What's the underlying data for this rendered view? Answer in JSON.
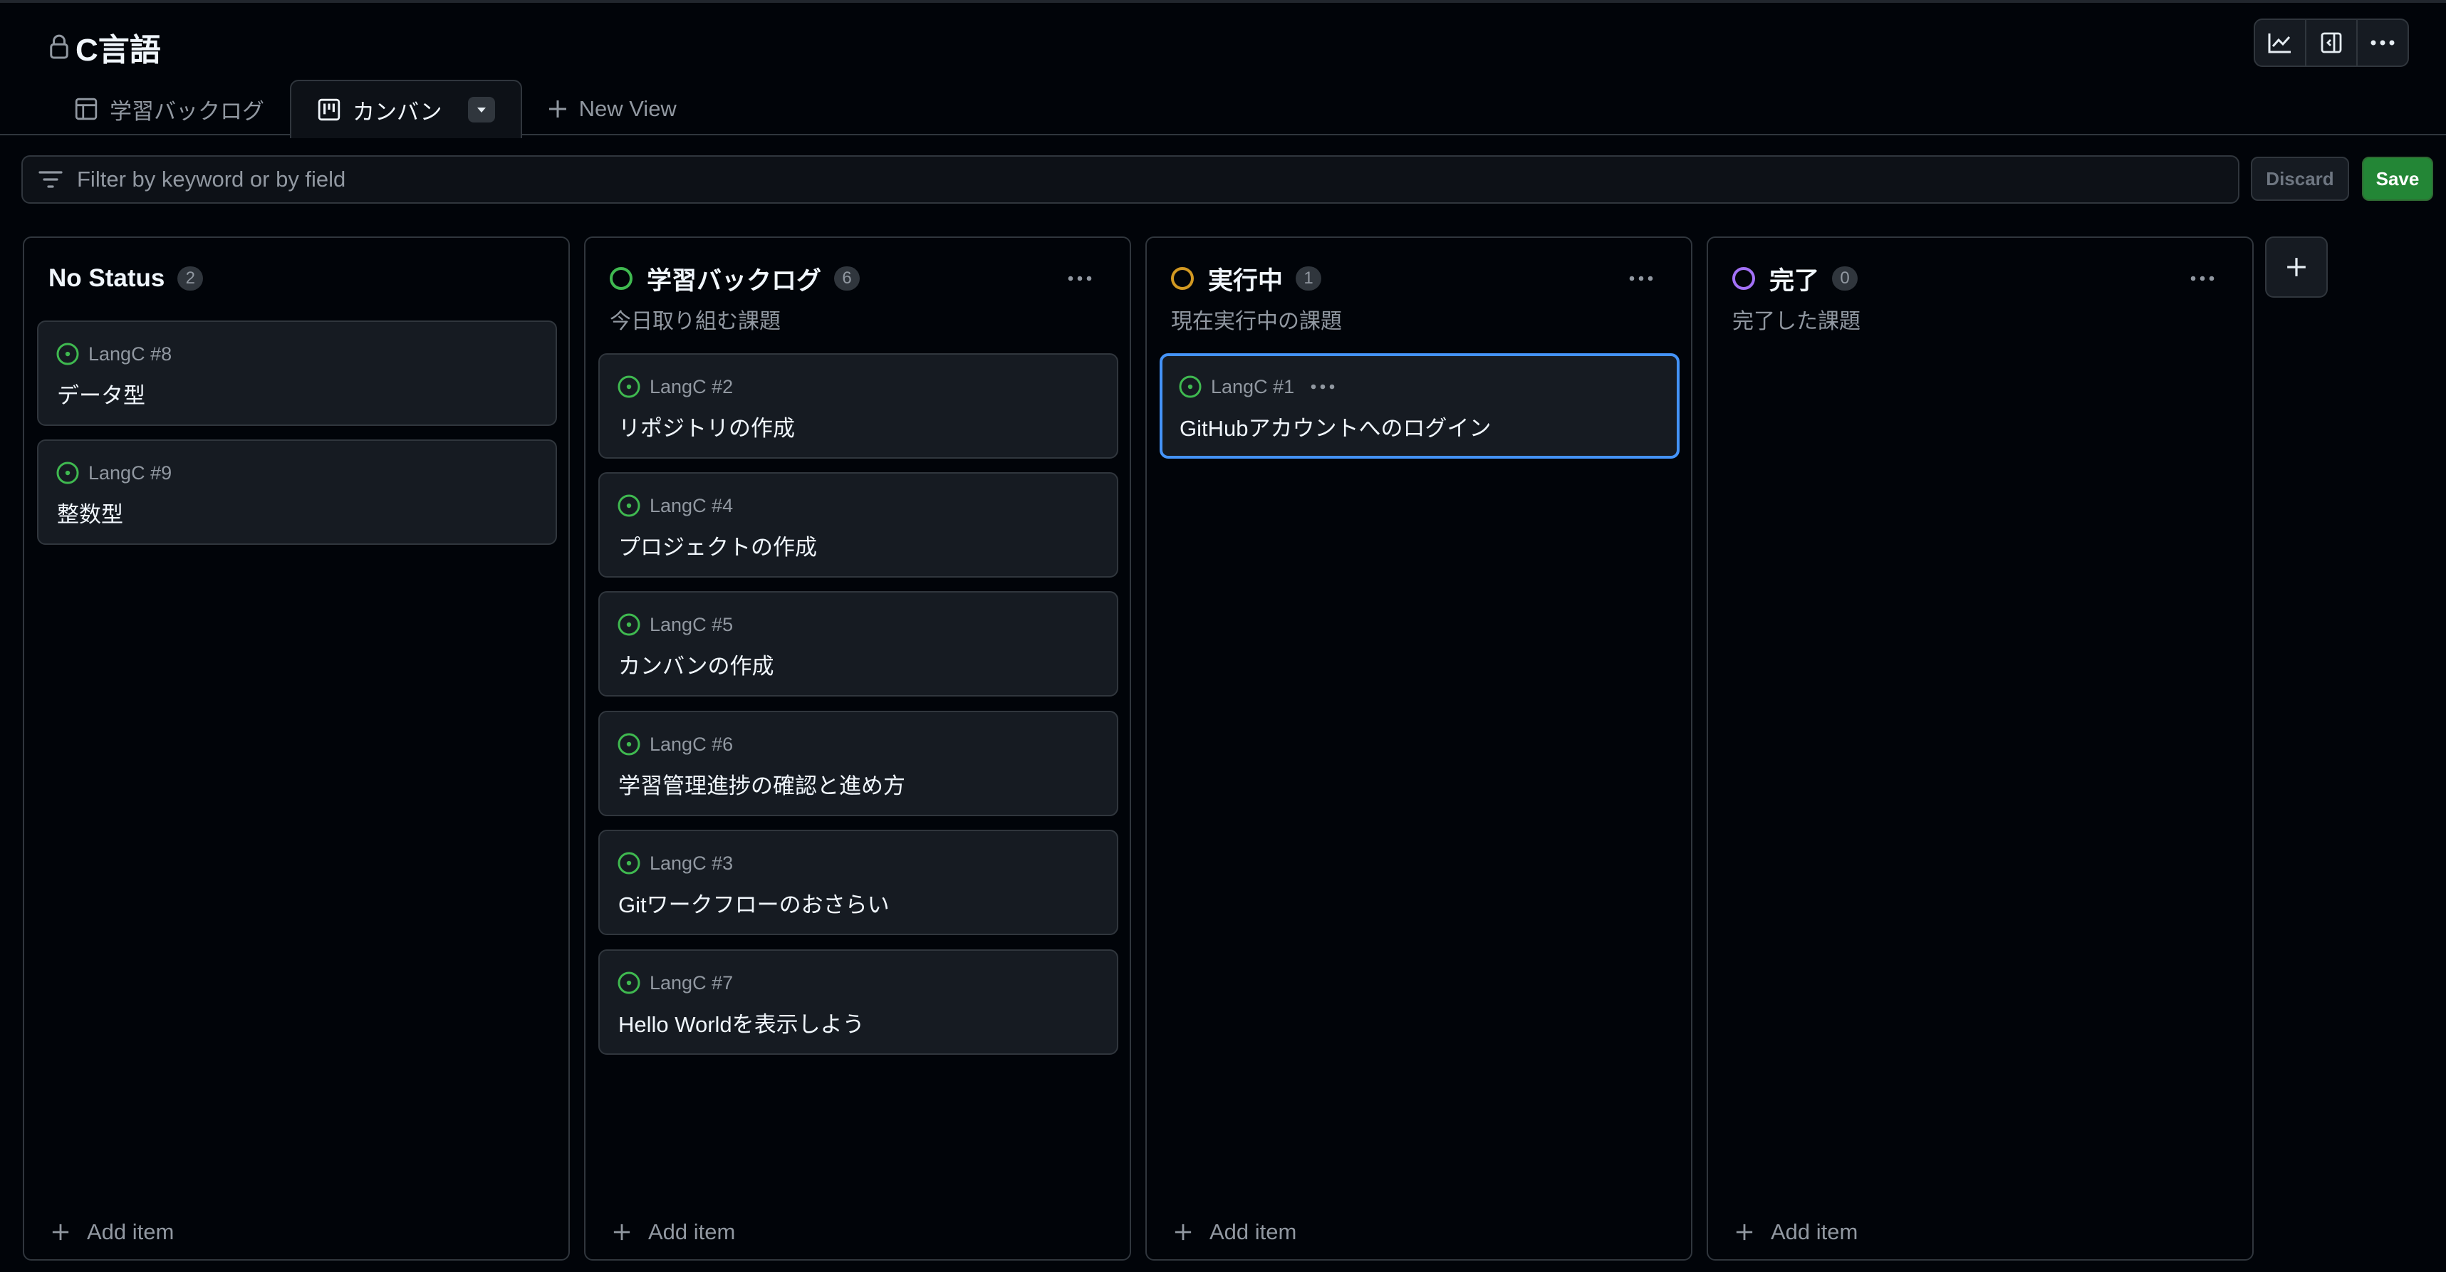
{
  "project": {
    "title": "C言語"
  },
  "tabs": [
    {
      "label": "学習バックログ",
      "icon": "table-icon"
    },
    {
      "label": "カンバン",
      "icon": "board-icon"
    },
    {
      "label": "New View",
      "icon": "plus-icon"
    }
  ],
  "filter": {
    "placeholder": "Filter by keyword or by field"
  },
  "actions": {
    "discard": "Discard",
    "save": "Save"
  },
  "columns": [
    {
      "name": "No Status",
      "count": "2",
      "description": "",
      "cards": [
        {
          "ref": "LangC #8",
          "title": "データ型"
        },
        {
          "ref": "LangC #9",
          "title": "整数型"
        }
      ],
      "add_label": "Add item"
    },
    {
      "name": "学習バックログ",
      "count": "6",
      "description": "今日取り組む課題",
      "ring_color": "#3fb950",
      "cards": [
        {
          "ref": "LangC #2",
          "title": "リポジトリの作成"
        },
        {
          "ref": "LangC #4",
          "title": "プロジェクトの作成"
        },
        {
          "ref": "LangC #5",
          "title": "カンバンの作成"
        },
        {
          "ref": "LangC #6",
          "title": "学習管理進捗の確認と進め方"
        },
        {
          "ref": "LangC #3",
          "title": "Gitワークフローのおさらい"
        },
        {
          "ref": "LangC #7",
          "title": "Hello Worldを表示しよう"
        }
      ],
      "add_label": "Add item"
    },
    {
      "name": "実行中",
      "count": "1",
      "description": "現在実行中の課題",
      "ring_color": "#d29922",
      "cards": [
        {
          "ref": "LangC #1",
          "title": "GitHubアカウントへのログイン"
        }
      ],
      "add_label": "Add item"
    },
    {
      "name": "完了",
      "count": "0",
      "description": "完了した課題",
      "ring_color": "#a371f7",
      "cards": [],
      "add_label": "Add item"
    }
  ],
  "colors": {
    "background": "#010409",
    "card": "#161b22",
    "border": "#30363d",
    "issue_open": "#3fb950",
    "selected": "#4493f8",
    "save": "#238636"
  }
}
